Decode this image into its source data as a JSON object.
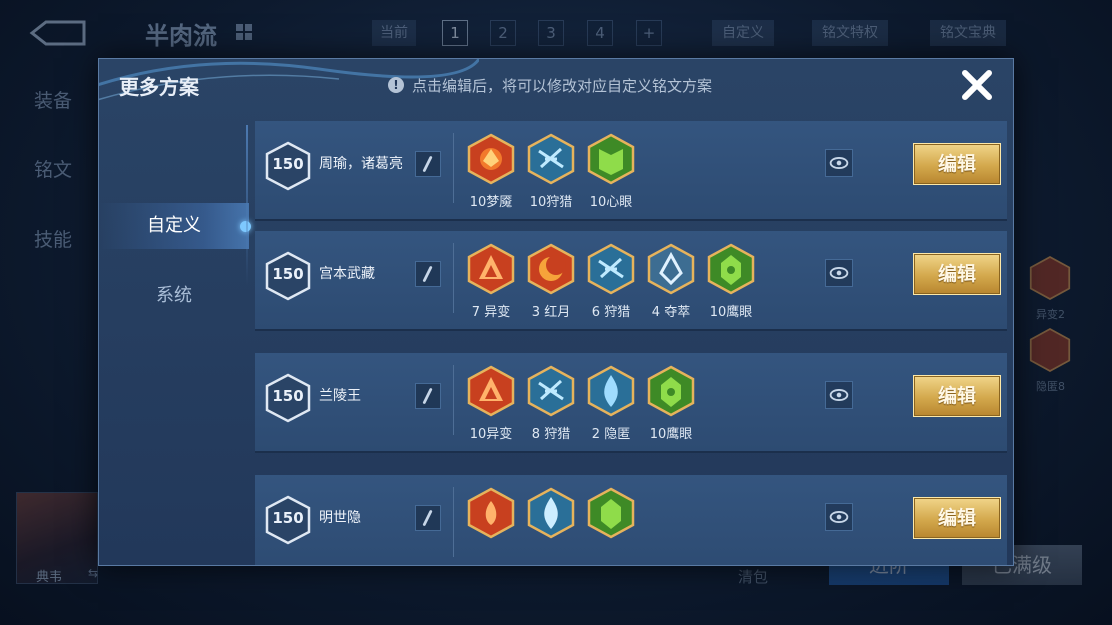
{
  "background": {
    "page_title": "半肉流",
    "current_label": "当前",
    "slots": [
      "1",
      "2",
      "3",
      "4",
      "+"
    ],
    "custom_label": "自定义",
    "rune_privilege_label": "铭文特权",
    "rune_codex_label": "铭文宝典",
    "side_tabs": [
      "装备",
      "铭文",
      "技能"
    ],
    "right_labels": [
      "异变2",
      "隐匿8"
    ],
    "hero_name": "典韦",
    "swap_glyph": "⇆",
    "bottom_text": "清包",
    "blue_button": "进阶",
    "grey_button": "已满级"
  },
  "modal": {
    "title": "更多方案",
    "hint_icon": "!",
    "hint": "点击编辑后，将可以修改对应自定义铭文方案",
    "nav": [
      {
        "label": "自定义",
        "active": true
      },
      {
        "label": "系统",
        "active": false
      }
    ],
    "rows": [
      {
        "level": "150",
        "name": "周瑜，诸葛亮",
        "runes": [
          {
            "label": "10梦魇",
            "color": "red",
            "icon": "dream-rune"
          },
          {
            "label": "10狩猎",
            "color": "blue",
            "icon": "hunt-rune"
          },
          {
            "label": "10心眼",
            "color": "green",
            "icon": "mind-eye-rune"
          }
        ],
        "edit_label": "编辑"
      },
      {
        "level": "150",
        "name": "宫本武藏",
        "runes": [
          {
            "label": "7 异变",
            "color": "red",
            "icon": "mutation-rune"
          },
          {
            "label": "3 红月",
            "color": "red",
            "icon": "red-moon-rune"
          },
          {
            "label": "6 狩猎",
            "color": "blue",
            "icon": "hunt-rune"
          },
          {
            "label": "4 夺萃",
            "color": "blue",
            "icon": "plunder-rune"
          },
          {
            "label": "10鹰眼",
            "color": "green",
            "icon": "hawk-eye-rune"
          }
        ],
        "edit_label": "编辑"
      },
      {
        "level": "150",
        "name": "兰陵王",
        "runes": [
          {
            "label": "10异变",
            "color": "red",
            "icon": "mutation-rune"
          },
          {
            "label": "8 狩猎",
            "color": "blue",
            "icon": "hunt-rune"
          },
          {
            "label": "2 隐匿",
            "color": "blue",
            "icon": "stealth-rune"
          },
          {
            "label": "10鹰眼",
            "color": "green",
            "icon": "hawk-eye-rune"
          }
        ],
        "edit_label": "编辑"
      },
      {
        "level": "150",
        "name": "明世隐",
        "runes": [
          {
            "label": "",
            "color": "red",
            "icon": "red-rune"
          },
          {
            "label": "",
            "color": "blue",
            "icon": "blue-rune"
          },
          {
            "label": "",
            "color": "green",
            "icon": "green-rune"
          }
        ],
        "edit_label": "编辑"
      }
    ]
  },
  "colors": {
    "accent_gold": "#d3a84c",
    "rune_red": "#c8401f",
    "rune_blue": "#5fb7e0",
    "rune_green": "#6fb83a",
    "modal_bg": "#2a4466"
  }
}
